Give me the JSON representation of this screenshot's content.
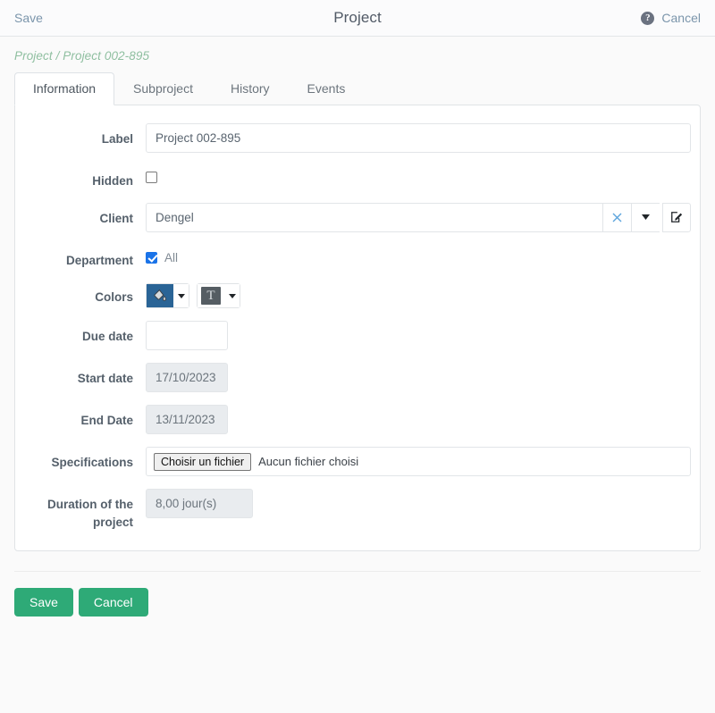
{
  "topbar": {
    "save_label": "Save",
    "title": "Project",
    "help_icon": "help-circle-icon",
    "cancel_label": "Cancel"
  },
  "breadcrumb": "Project / Project 002-895",
  "tabs": [
    {
      "label": "Information",
      "active": true
    },
    {
      "label": "Subproject",
      "active": false
    },
    {
      "label": "History",
      "active": false
    },
    {
      "label": "Events",
      "active": false
    }
  ],
  "form": {
    "label": {
      "label": "Label",
      "value": "Project 002-895"
    },
    "hidden": {
      "label": "Hidden",
      "checked": false
    },
    "client": {
      "label": "Client",
      "value": "Dengel",
      "clear_icon": "close-x-icon",
      "dropdown_icon": "chevron-down-icon",
      "edit_icon": "edit-pencil-square-icon"
    },
    "department": {
      "label": "Department",
      "checkbox_label": "All",
      "checked": true
    },
    "colors": {
      "label": "Colors",
      "background_icon": "paint-bucket-icon",
      "background_swatch": "#2a6496",
      "text_icon": "text-color-T-icon",
      "text_swatch": "#555d63",
      "caret_icon": "caret-down-icon"
    },
    "due_date": {
      "label": "Due date",
      "value": ""
    },
    "start_date": {
      "label": "Start date",
      "value": "17/10/2023"
    },
    "end_date": {
      "label": "End Date",
      "value": "13/11/2023"
    },
    "specifications": {
      "label": "Specifications",
      "choose_button": "Choisir un fichier",
      "file_status": "Aucun fichier choisi"
    },
    "duration": {
      "label": "Duration of the project",
      "value": "8,00 jour(s)"
    }
  },
  "footer": {
    "save_label": "Save",
    "cancel_label": "Cancel"
  },
  "colors": {
    "accent_green": "#2eaa77",
    "link_blue": "#7b95ab",
    "breadcrumb_green": "#8fbfa0",
    "checkbox_blue": "#1a73e8"
  }
}
